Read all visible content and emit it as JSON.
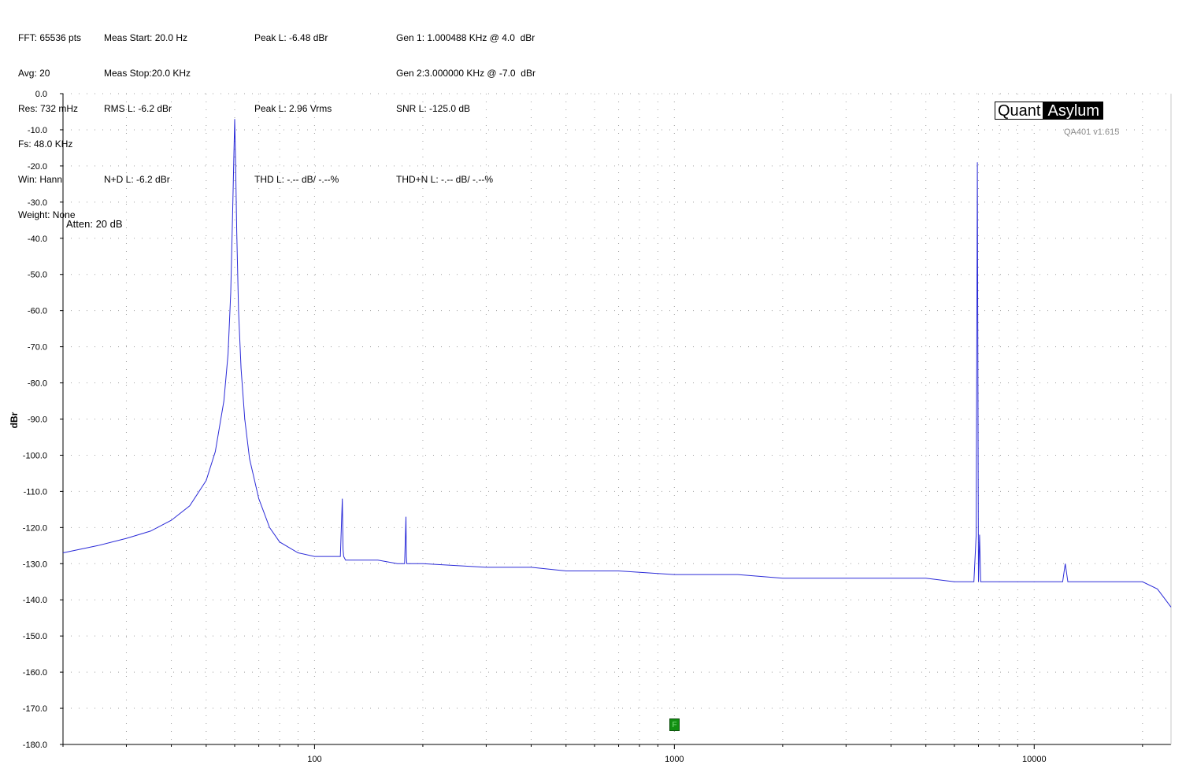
{
  "header": {
    "col1": [
      "FFT: 65536 pts",
      "Avg: 20",
      "Res: 732 mHz",
      "Fs: 48.0 KHz",
      "Win: Hann",
      "Weight: None"
    ],
    "col2": [
      "Meas Start: 20.0 Hz",
      "Meas Stop:20.0 KHz",
      "RMS L: -6.2 dBr",
      "",
      "N+D L: -6.2 dBr"
    ],
    "col3": [
      "Peak L: -6.48 dBr",
      "",
      "Peak L: 2.96 Vrms",
      "",
      "THD L: -.-- dB/ -.--%"
    ],
    "col4": [
      "Gen 1: 1.000488 KHz @ 4.0  dBr",
      "Gen 2:3.000000 KHz @ -7.0  dBr",
      "SNR L: -125.0 dB",
      "",
      "THD+N L: -.-- dB/ -.--%"
    ]
  },
  "annotation": "Atten: 20 dB",
  "logo": {
    "left": "Quant",
    "right": "Asylum"
  },
  "version": "QA401 v1.615",
  "marker_label": "F",
  "colors": {
    "trace": "#2b2bd8",
    "grid": "#a0a0a0",
    "marker": "#118f11"
  },
  "chart_data": {
    "type": "line",
    "xscale": "log",
    "xlim": [
      20,
      24000
    ],
    "ylim": [
      -180,
      0
    ],
    "ylabel": "dBr",
    "xlabel": "",
    "yticks": [
      0,
      -10,
      -20,
      -30,
      -40,
      -50,
      -60,
      -70,
      -80,
      -90,
      -100,
      -110,
      -120,
      -130,
      -140,
      -150,
      -160,
      -170,
      -180
    ],
    "ytick_labels": [
      "0.0",
      "-10.0",
      "-20.0",
      "-30.0",
      "-40.0",
      "-50.0",
      "-60.0",
      "-70.0",
      "-80.0",
      "-90.0",
      "-100.0",
      "-110.0",
      "-120.0",
      "-130.0",
      "-140.0",
      "-150.0",
      "-160.0",
      "-170.0",
      "-180.0"
    ],
    "xticks": [
      100,
      1000,
      10000
    ],
    "xtick_labels": [
      "100",
      "1000",
      "10000"
    ],
    "grid": true,
    "series": [
      {
        "x": [
          20,
          25,
          30,
          35,
          40,
          45,
          50,
          53,
          56,
          57.5,
          58.5,
          59.2,
          59.7,
          60,
          60.3,
          60.8,
          61.5,
          62.5,
          64,
          66,
          70,
          75,
          80,
          90,
          100,
          110,
          118,
          119.5,
          120,
          120.5,
          122,
          130,
          150,
          170,
          178,
          179.5,
          180,
          180.5,
          182,
          200,
          300,
          400,
          500,
          700,
          1000,
          1500,
          2000,
          3000,
          4000,
          5000,
          6000,
          6800,
          6900,
          6950,
          7000,
          7050,
          7100,
          7200,
          8000,
          10000,
          12000,
          12200,
          12400,
          15000,
          18000,
          20000,
          22000,
          24000
        ],
        "y": [
          -127,
          -125,
          -123,
          -121,
          -118,
          -114,
          -107,
          -99,
          -85,
          -72,
          -55,
          -33,
          -17,
          -7,
          -17,
          -38,
          -60,
          -76,
          -90,
          -101,
          -112,
          -120,
          -124,
          -127,
          -128,
          -128,
          -128,
          -112,
          -126,
          -128,
          -129,
          -129,
          -129,
          -130,
          -130,
          -117,
          -128,
          -130,
          -130,
          -130,
          -131,
          -131,
          -132,
          -132,
          -133,
          -133,
          -134,
          -134,
          -134,
          -134,
          -135,
          -135,
          -122,
          -19,
          -135,
          -122,
          -135,
          -135,
          -135,
          -135,
          -135,
          -130,
          -135,
          -135,
          -135,
          -135,
          -137,
          -142
        ]
      }
    ]
  }
}
